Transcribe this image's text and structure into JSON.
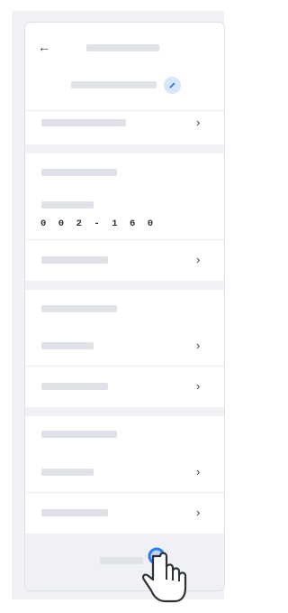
{
  "header": {
    "back_icon": "arrow-left-icon",
    "edit_icon": "pencil-icon",
    "accent_color": "#2f7cf6"
  },
  "sections": {
    "code_section": {
      "code_value": "0 0 2 - 1 6 0"
    }
  },
  "row_chevron": "›",
  "pointer_icon": "hand-pointer-icon"
}
